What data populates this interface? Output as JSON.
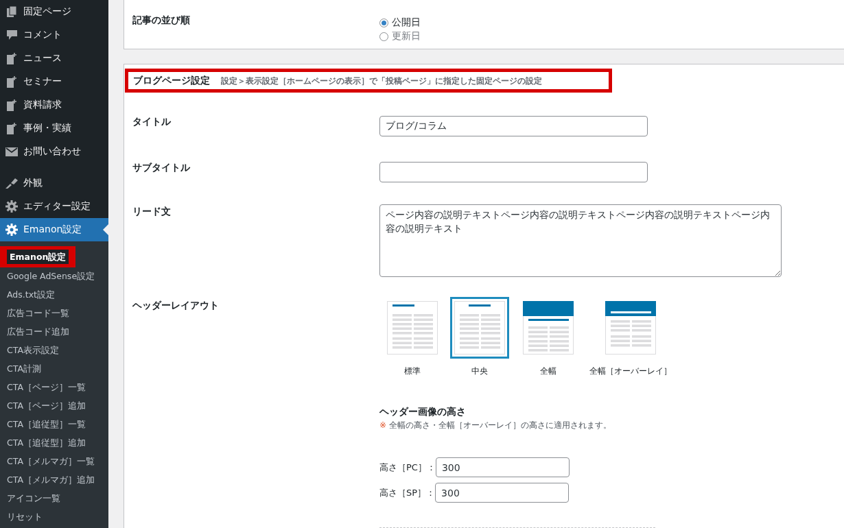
{
  "sidebar": {
    "groups": [
      [
        {
          "label": "固定ページ",
          "kind": "pages",
          "current": false
        },
        {
          "label": "コメント",
          "kind": "comments",
          "current": false
        },
        {
          "label": "ニュース",
          "kind": "post",
          "current": false
        },
        {
          "label": "セミナー",
          "kind": "post",
          "current": false
        },
        {
          "label": "資料請求",
          "kind": "post",
          "current": false
        },
        {
          "label": "事例・実績",
          "kind": "post",
          "current": false
        },
        {
          "label": "お問い合わせ",
          "kind": "mail",
          "current": false
        }
      ],
      [
        {
          "label": "外観",
          "kind": "appearance",
          "current": false
        },
        {
          "label": "エディター設定",
          "kind": "settings",
          "current": false
        },
        {
          "label": "Emanon設定",
          "kind": "settings",
          "current": true
        }
      ]
    ],
    "submenu": [
      {
        "label": "Emanon設定",
        "current": true,
        "highlighted": true
      },
      {
        "label": "Google AdSense設定",
        "current": false,
        "highlighted": false
      },
      {
        "label": "Ads.txt設定",
        "current": false,
        "highlighted": false
      },
      {
        "label": "広告コード一覧",
        "current": false,
        "highlighted": false
      },
      {
        "label": "広告コード追加",
        "current": false,
        "highlighted": false
      },
      {
        "label": "CTA表示設定",
        "current": false,
        "highlighted": false
      },
      {
        "label": "CTA計測",
        "current": false,
        "highlighted": false
      },
      {
        "label": "CTA［ページ］一覧",
        "current": false,
        "highlighted": false
      },
      {
        "label": "CTA［ページ］追加",
        "current": false,
        "highlighted": false
      },
      {
        "label": "CTA［追従型］一覧",
        "current": false,
        "highlighted": false
      },
      {
        "label": "CTA［追従型］追加",
        "current": false,
        "highlighted": false
      },
      {
        "label": "CTA［メルマガ］一覧",
        "current": false,
        "highlighted": false
      },
      {
        "label": "CTA［メルマガ］追加",
        "current": false,
        "highlighted": false
      },
      {
        "label": "アイコン一覧",
        "current": false,
        "highlighted": false
      },
      {
        "label": "リセット",
        "current": false,
        "highlighted": false
      }
    ]
  },
  "sort_panel": {
    "label": "記事の並び順",
    "options": [
      {
        "label": "公開日",
        "selected": true
      },
      {
        "label": "更新日",
        "selected": false
      }
    ]
  },
  "blog_panel": {
    "heading": "ブログページ設定",
    "description": "設定＞表示設定［ホームページの表示］で「投稿ページ」に指定した固定ページの設定",
    "highlighted": true,
    "fields": [
      {
        "label": "タイトル",
        "kind": "text",
        "value": "ブログ/コラム"
      },
      {
        "label": "サブタイトル",
        "kind": "text"
      },
      {
        "label": "リード文",
        "kind": "textarea",
        "value": "ページ内容の説明テキストページ内容の説明テキストページ内容の説明テキストページ内容の説明テキスト"
      }
    ],
    "header_layout": {
      "label": "ヘッダーレイアウト",
      "options": [
        {
          "label": "標準",
          "kind": "standard",
          "selected": false
        },
        {
          "label": "中央",
          "kind": "center",
          "selected": true
        },
        {
          "label": "全幅",
          "kind": "full",
          "selected": false
        },
        {
          "label": "全幅［オーバーレイ］",
          "kind": "overlay",
          "selected": false
        }
      ]
    },
    "image_height": {
      "title": "ヘッダー画像の高さ",
      "note_mark": "※",
      "note": "全幅の高さ・全幅［オーバーレイ］の高さに適用されます。",
      "inputs": [
        {
          "label": "高さ［PC］：",
          "value": "300"
        },
        {
          "label": "高さ［SP］：",
          "value": "300"
        }
      ]
    }
  }
}
